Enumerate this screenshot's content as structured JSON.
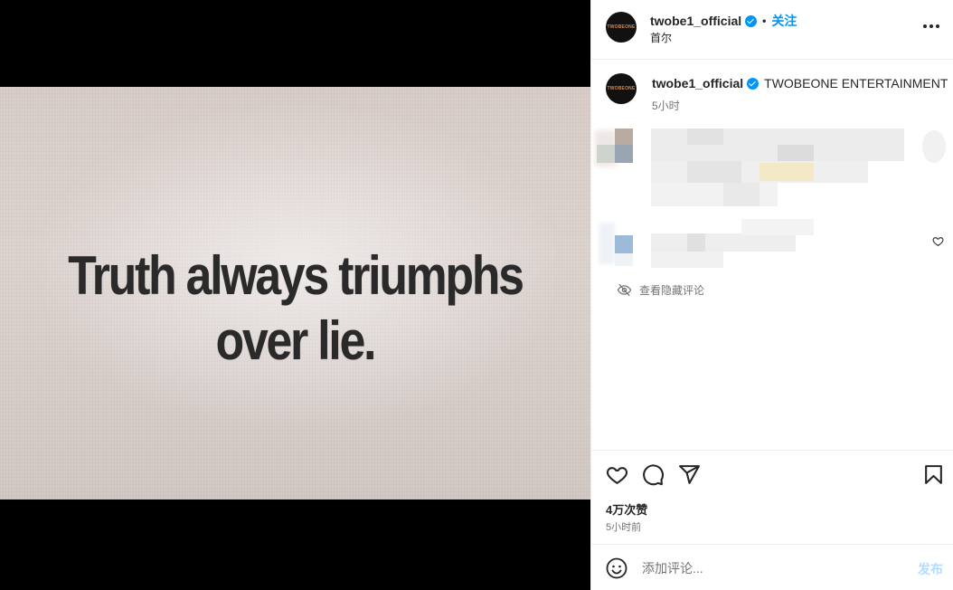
{
  "post": {
    "image_text_line1": "Truth always triumphs",
    "image_text_line2": "over lie."
  },
  "header": {
    "username": "twobe1_official",
    "separator": "•",
    "follow_label": "关注",
    "location": "首尔",
    "avatar_icon": "twobeone-logo-icon",
    "more_icon": "more-options-icon"
  },
  "caption": {
    "username": "twobe1_official",
    "text": "TWOBEONE ENTERTAINMENT",
    "time": "5小时"
  },
  "comments": {
    "view_hidden_label": "查看隐藏评论",
    "hidden_icon": "eye-off-icon"
  },
  "actions": {
    "likes": "4万次赞",
    "time_ago": "5小时前",
    "icons": [
      "heart-icon",
      "comment-icon",
      "share-icon",
      "bookmark-icon"
    ]
  },
  "comment_box": {
    "placeholder": "添加评论...",
    "post_label": "发布",
    "emoji_icon": "emoji-icon"
  },
  "colors": {
    "accent": "#0095f6",
    "muted_text": "#737373",
    "post_disabled": "#b3dbff"
  }
}
